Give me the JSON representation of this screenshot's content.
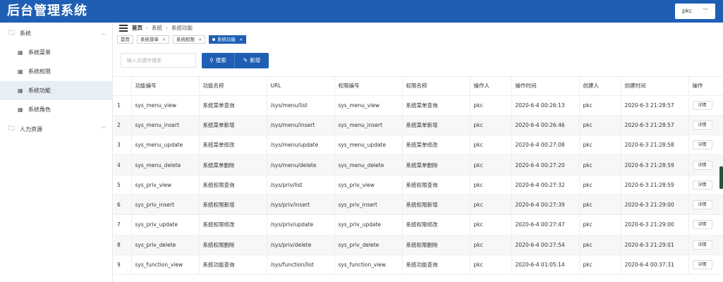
{
  "app": {
    "title": "后台管理系统"
  },
  "user": {
    "name": "pkc"
  },
  "sidebar": {
    "groups": [
      {
        "label": "系统",
        "items": [
          "系统菜单",
          "系统权限",
          "系统功能",
          "系统角色"
        ]
      },
      {
        "label": "人力资源",
        "items": []
      }
    ],
    "active_item": "系统功能"
  },
  "breadcrumb": [
    "首页",
    "系统",
    "系统功能"
  ],
  "tabs": [
    {
      "label": "首页",
      "closable": false,
      "active": false
    },
    {
      "label": "系统菜单",
      "closable": true,
      "active": false
    },
    {
      "label": "系统权限",
      "closable": true,
      "active": false
    },
    {
      "label": "系统功能",
      "closable": true,
      "active": true
    }
  ],
  "toolbar": {
    "search_placeholder": "输入关键字搜索",
    "search_label": "搜索",
    "add_label": "新增"
  },
  "table": {
    "columns": [
      "",
      "功能编号",
      "功能名称",
      "URL",
      "权限编号",
      "权限名称",
      "操作人",
      "操作时间",
      "创建人",
      "创建时间",
      "操作"
    ],
    "detail_label": "详情",
    "rows": [
      [
        "1",
        "sys_menu_view",
        "系统菜单查询",
        "/sys/menu/list",
        "sys_menu_view",
        "系统菜单查询",
        "pkc",
        "2020-6-4 00:26:13",
        "pkc",
        "2020-6-3 21:28:57"
      ],
      [
        "2",
        "sys_menu_insert",
        "系统菜单新增",
        "/sys/menu/insert",
        "sys_menu_insert",
        "系统菜单新增",
        "pkc",
        "2020-6-4 00:26:46",
        "pkc",
        "2020-6-3 21:28:57"
      ],
      [
        "3",
        "sys_menu_update",
        "系统菜单修改",
        "/sys/menu/update",
        "sys_menu_update",
        "系统菜单修改",
        "pkc",
        "2020-6-4 00:27:08",
        "pkc",
        "2020-6-3 21:28:58"
      ],
      [
        "4",
        "sys_menu_delete",
        "系统菜单删除",
        "/sys/menu/delete",
        "sys_menu_delete",
        "系统菜单删除",
        "pkc",
        "2020-6-4 00:27:20",
        "pkc",
        "2020-6-3 21:28:59"
      ],
      [
        "5",
        "sys_priv_view",
        "系统权限查询",
        "/sys/priv/list",
        "sys_priv_view",
        "系统权限查询",
        "pkc",
        "2020-6-4 00:27:32",
        "pkc",
        "2020-6-3 21:28:59"
      ],
      [
        "6",
        "sys_priv_insert",
        "系统权限新增",
        "/sys/priv/insert",
        "sys_priv_insert",
        "系统权限新增",
        "pkc",
        "2020-6-4 00:27:39",
        "pkc",
        "2020-6-3 21:29:00"
      ],
      [
        "7",
        "sys_priv_update",
        "系统权限修改",
        "/sys/priv/update",
        "sys_priv_update",
        "系统权限修改",
        "pkc",
        "2020-6-4 00:27:47",
        "pkc",
        "2020-6-3 21:29:00"
      ],
      [
        "8",
        "sys_priv_delete",
        "系统权限删除",
        "/sys/priv/delete",
        "sys_priv_delete",
        "系统权限删除",
        "pkc",
        "2020-6-4 00:27:54",
        "pkc",
        "2020-6-3 21:29:01"
      ],
      [
        "9",
        "sys_function_view",
        "系统功能查询",
        "/sys/function/list",
        "sys_function_view",
        "系统功能查询",
        "pkc",
        "2020-6-4 01:05:14",
        "pkc",
        "2020-6-4 00:37:31"
      ]
    ]
  },
  "colors": {
    "brand": "#1e5fb4",
    "active_menu_bg": "#e8eef6"
  }
}
